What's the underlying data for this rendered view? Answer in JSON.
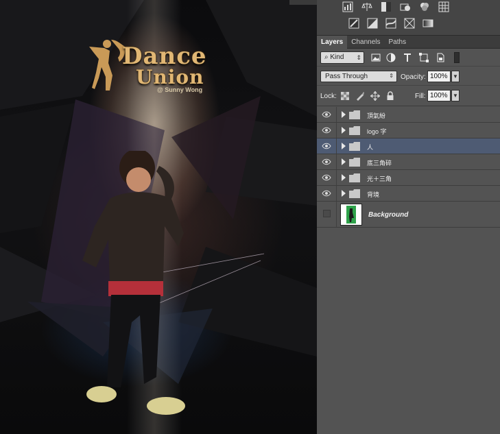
{
  "canvas": {
    "logo": {
      "line1": "Dance",
      "line2": "Union",
      "credit": "@ Sunny Wong"
    }
  },
  "adjustments": {
    "row1": [
      "levels-icon",
      "balance-icon",
      "black-white-icon",
      "photo-filter-icon",
      "channel-mixer-icon",
      "color-lookup-icon"
    ],
    "row2": [
      "invert-icon",
      "posterize-icon",
      "threshold-icon",
      "selective-color-icon",
      "gradient-map-icon"
    ]
  },
  "panel": {
    "tabs": [
      {
        "label": "Layers",
        "active": true
      },
      {
        "label": "Channels",
        "active": false
      },
      {
        "label": "Paths",
        "active": false
      }
    ],
    "filter": {
      "kind_label": "Kind"
    },
    "blend": {
      "mode": "Pass Through",
      "opacity_label": "Opacity:",
      "opacity_value": "100%",
      "lock_label": "Lock:",
      "fill_label": "Fill:",
      "fill_value": "100%"
    },
    "layers": [
      {
        "name": "頂氣紛",
        "visible": true,
        "selected": false
      },
      {
        "name": "logo 字",
        "visible": true,
        "selected": false
      },
      {
        "name": "人",
        "visible": true,
        "selected": true
      },
      {
        "name": "底三角碎",
        "visible": true,
        "selected": false
      },
      {
        "name": "光＋三角",
        "visible": true,
        "selected": false
      },
      {
        "name": "背境",
        "visible": true,
        "selected": false
      }
    ],
    "background_layer": {
      "name": "Background",
      "visible": false
    }
  },
  "colors": {
    "panel_bg": "#535353",
    "selected_row": "#4e5b73",
    "logo_gold": "#e1b774"
  }
}
